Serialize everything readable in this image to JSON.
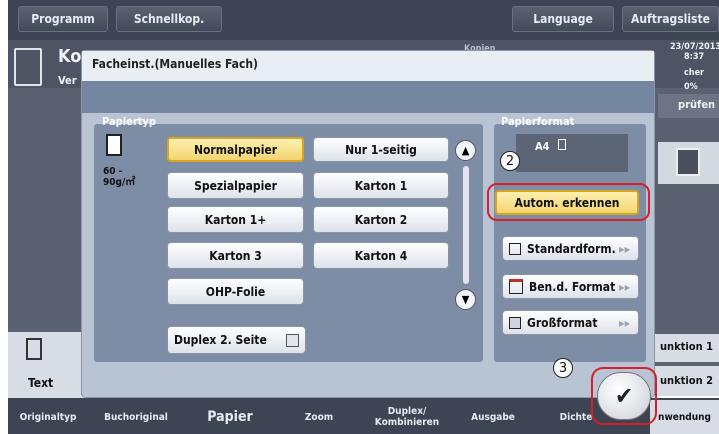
{
  "topbar": {
    "programm": "Programm",
    "schnellkop": "Schnellkop.",
    "language": "Language",
    "auftragsliste": "Auftragsliste"
  },
  "background": {
    "title_fragment": "Kop",
    "subtitle_fragment": "Ver",
    "kopien_fragment": "Kopien",
    "date_fragment": "23/07/2013",
    "time_fragment": "8:37",
    "speicher_fragment": "cher",
    "percent_fragment": "0%",
    "prufen_fragment": "prüfen",
    "text_label": "Text",
    "funktion1": "unktion 1",
    "funktion2": "unktion 2",
    "anwendung": "nwendung"
  },
  "tabs": [
    "Originaltyp",
    "Buchoriginal",
    "Papier",
    "Zoom",
    "Duplex/\nKombinieren",
    "Ausgabe",
    "Dichte"
  ],
  "dialog": {
    "title": "Facheinst.(Manuelles Fach)",
    "papiertyp": {
      "label": "Papiertyp",
      "weight": "60 -\n90g/㎡",
      "buttons": [
        "Normalpapier",
        "Nur 1-seitig",
        "Spezialpapier",
        "Karton 1",
        "Karton 1+",
        "Karton 2",
        "Karton 3",
        "Karton 4",
        "OHP-Folie"
      ],
      "selected": "Normalpapier",
      "duplex_label": "Duplex 2. Seite"
    },
    "papierformat": {
      "label": "Papierformat",
      "current": "A4",
      "auto_button": "Autom. erkennen",
      "standard_button": "Standardform.",
      "custom_button": "Ben.d. Format",
      "large_button": "Großformat"
    }
  },
  "callouts": {
    "two": "2",
    "three": "3"
  },
  "colors": {
    "selected_fill": "#f3d470",
    "highlight_ring": "#d4202a",
    "panel": "#7d8da6"
  }
}
